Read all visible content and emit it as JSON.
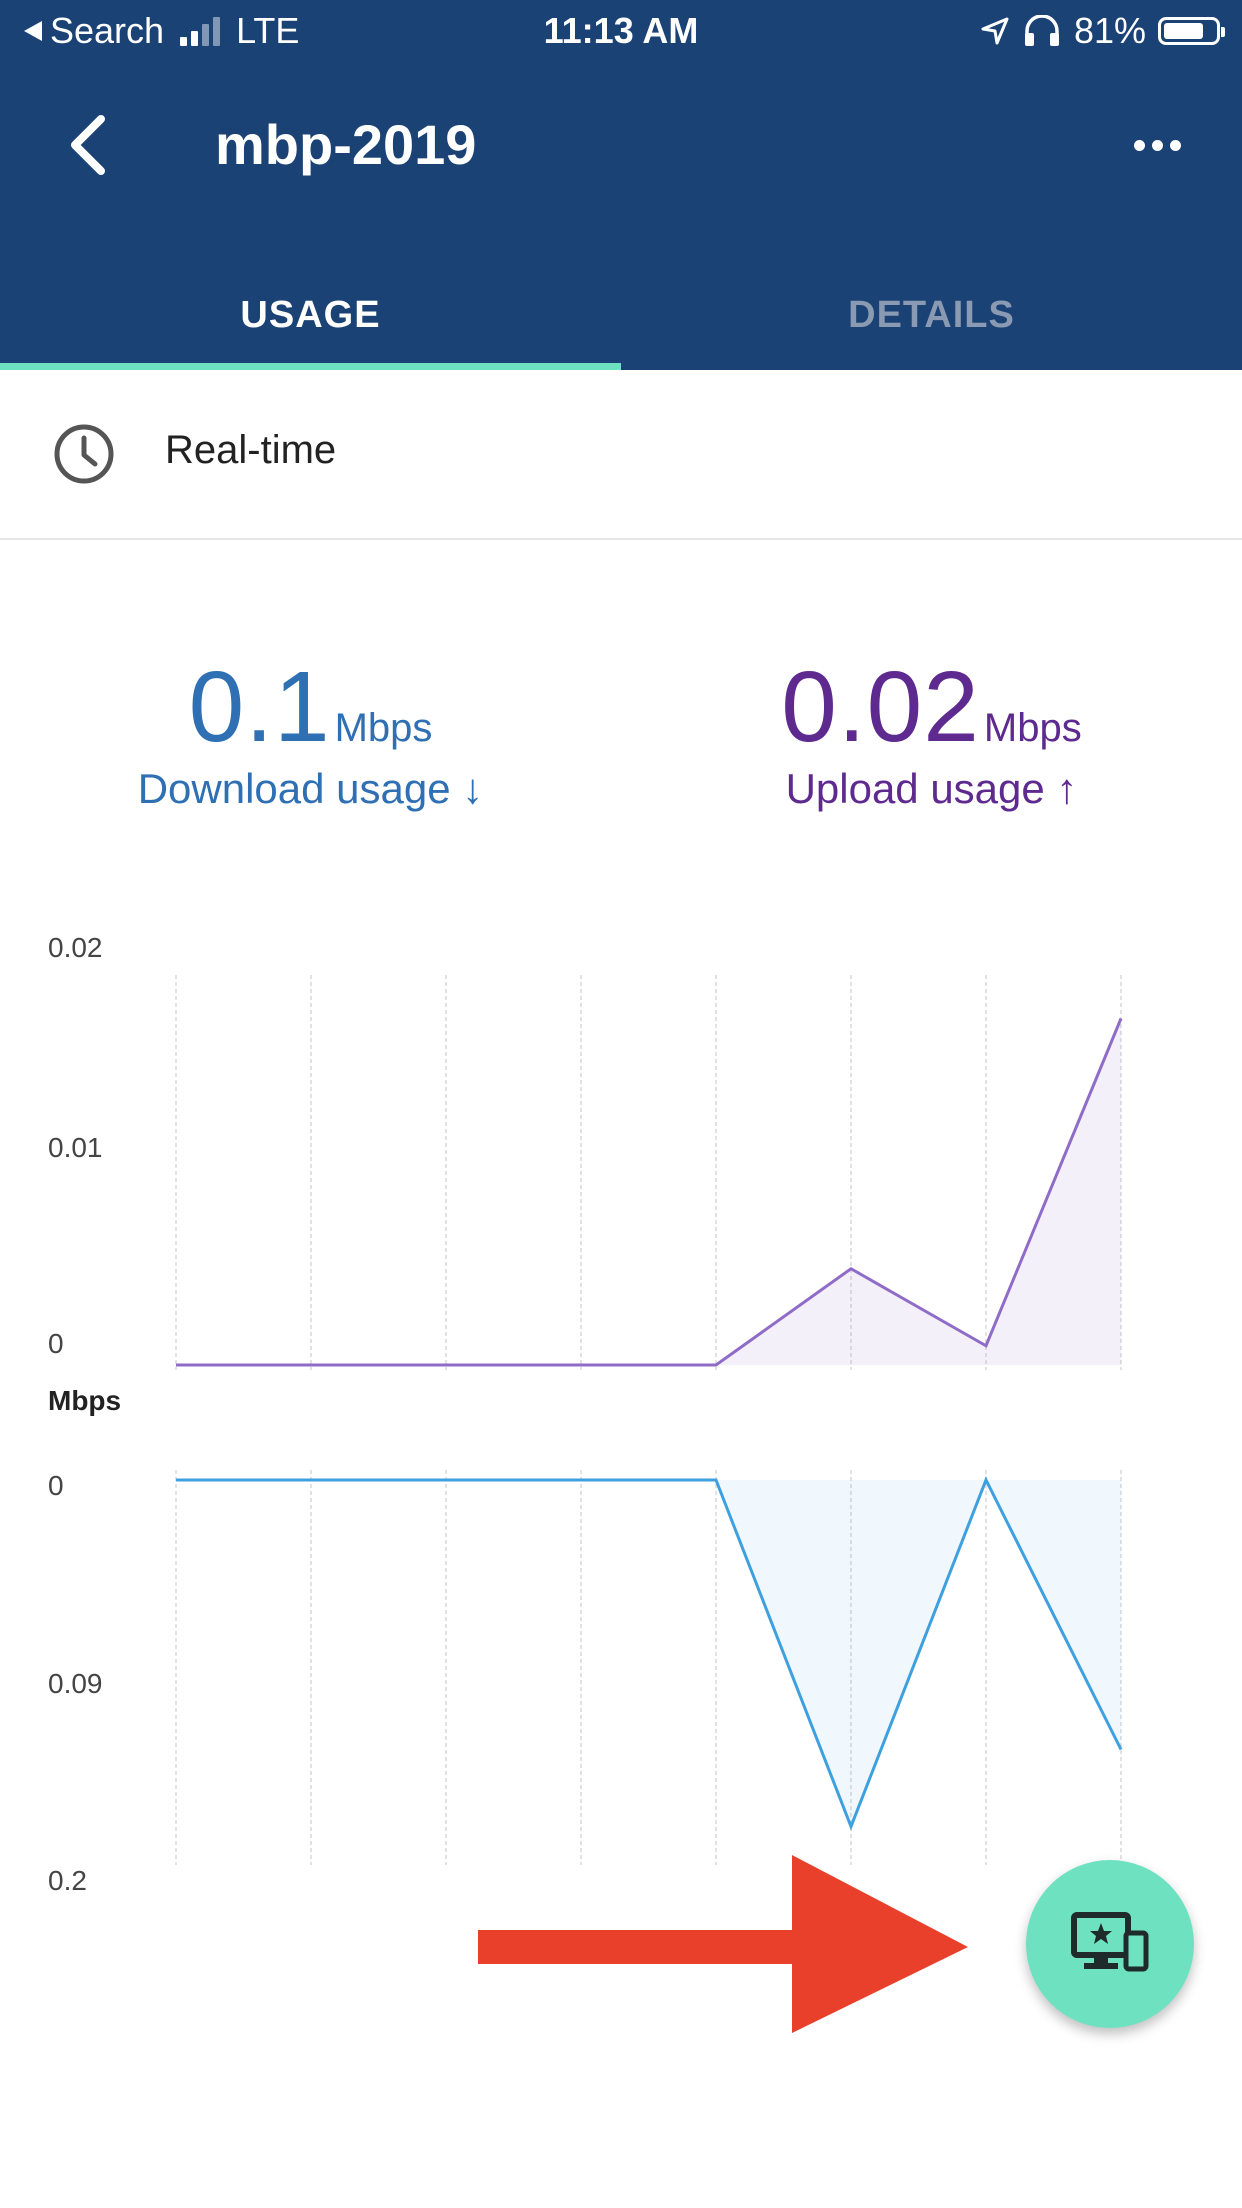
{
  "statusbar": {
    "back_app": "Search",
    "carrier": "LTE",
    "time": "11:13 AM",
    "battery": "81%",
    "battery_level": 0.81
  },
  "toolbar": {
    "title": "mbp-2019",
    "back_icon": "chevron-left-icon",
    "more_icon": "more-horizontal-icon"
  },
  "tabs": [
    {
      "label": "USAGE",
      "active": true
    },
    {
      "label": "DETAILS",
      "active": false
    }
  ],
  "period": {
    "label": "Real-time",
    "icon": "clock-icon"
  },
  "download": {
    "value": "0.1",
    "unit": "Mbps",
    "label": "Download usage ↓",
    "color": "#2f6fb3"
  },
  "upload": {
    "value": "0.02",
    "unit": "Mbps",
    "label": "Upload usage ↑",
    "color": "#5e2a8f"
  },
  "chart_data": [
    {
      "type": "area",
      "ylabel": "Mbps",
      "ylim": [
        0,
        0.02
      ],
      "y_ticks": [
        "0.02",
        "0.01",
        "0"
      ],
      "series": [
        {
          "values": [
            0,
            0,
            0,
            0,
            0,
            0.005,
            0.001,
            0.018
          ],
          "color": "#8f6cc8"
        }
      ]
    },
    {
      "type": "area",
      "ylim": [
        0,
        0.2
      ],
      "inverted": true,
      "y_ticks": [
        "0",
        "0.09",
        "0.2"
      ],
      "series": [
        {
          "values": [
            0,
            0,
            0,
            0,
            0,
            0.18,
            0,
            0.14
          ],
          "color": "#3fa0e0"
        }
      ]
    }
  ],
  "fab": {
    "icon": "devices-star-icon"
  },
  "annotation": {
    "icon": "red-arrow-icon",
    "color": "#e8402b"
  }
}
